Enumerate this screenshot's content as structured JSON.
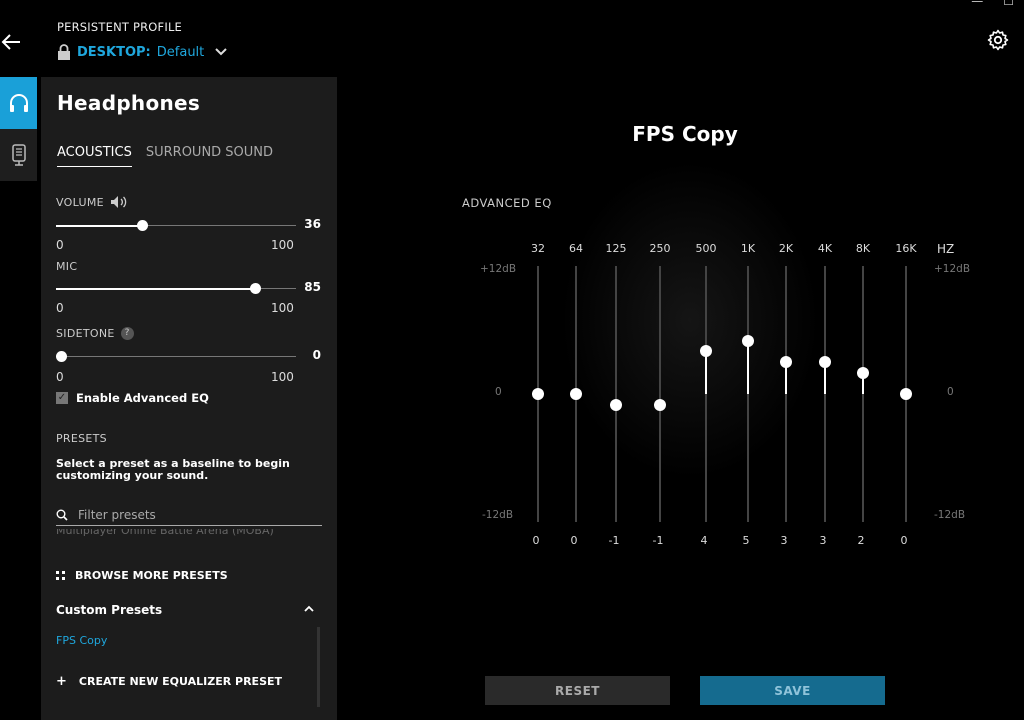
{
  "header": {
    "profile_label": "PERSISTENT PROFILE",
    "profile_device": "DESKTOP:",
    "profile_name": "Default"
  },
  "panel": {
    "title": "Headphones",
    "tabs": [
      "ACOUSTICS",
      "SURROUND SOUND"
    ],
    "active_tab": "ACOUSTICS",
    "volume": {
      "label": "VOLUME",
      "value": "36",
      "min": "0",
      "max": "100"
    },
    "mic": {
      "label": "MIC",
      "value": "85",
      "min": "0",
      "max": "100"
    },
    "sidetone": {
      "label": "SIDETONE",
      "help": "?",
      "value": "0",
      "min": "0",
      "max": "100"
    },
    "advanced_eq": {
      "label": "Enable Advanced EQ",
      "checked": true
    },
    "presets": {
      "heading": "PRESETS",
      "description": "Select a preset as a baseline to begin customizing your sound.",
      "filter_placeholder": "Filter presets",
      "partial_item": "Multiplayer Online Battle Arena (MOBA)",
      "browse_label": "BROWSE MORE PRESETS",
      "custom_heading": "Custom Presets",
      "custom_items": [
        "FPS Copy"
      ],
      "create_label": "CREATE NEW EQUALIZER PRESET"
    }
  },
  "main": {
    "title": "FPS Copy",
    "eq_label": "ADVANCED EQ",
    "hz_label": "HZ",
    "scale": {
      "top": "+12dB",
      "mid": "0",
      "bottom": "-12dB"
    },
    "bands": [
      {
        "freq": "32",
        "gain": "0"
      },
      {
        "freq": "64",
        "gain": "0"
      },
      {
        "freq": "125",
        "gain": "-1"
      },
      {
        "freq": "250",
        "gain": "-1"
      },
      {
        "freq": "500",
        "gain": "4"
      },
      {
        "freq": "1K",
        "gain": "5"
      },
      {
        "freq": "2K",
        "gain": "3"
      },
      {
        "freq": "4K",
        "gain": "3"
      },
      {
        "freq": "8K",
        "gain": "2"
      },
      {
        "freq": "16K",
        "gain": "0"
      }
    ],
    "reset_label": "RESET",
    "save_label": "SAVE"
  },
  "colors": {
    "accent": "#1fa7dd",
    "save_bg": "#156b8f"
  }
}
